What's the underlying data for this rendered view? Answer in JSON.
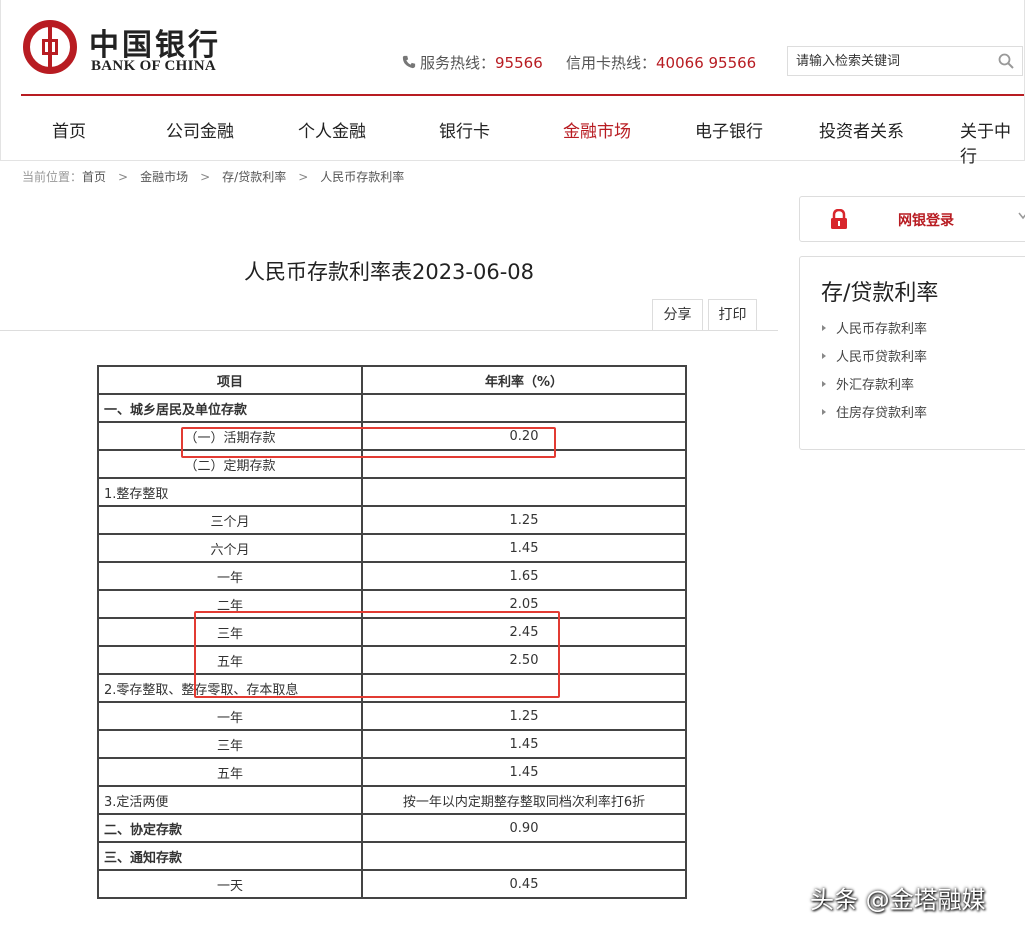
{
  "brand": {
    "name_cn": "中国银行",
    "name_en": "BANK OF CHINA",
    "color": "#b81c22"
  },
  "header": {
    "service_label": "服务热线：",
    "service_number": "95566",
    "credit_label": "信用卡热线：",
    "credit_number": "40066 95566",
    "search_placeholder": "请输入检索关键词",
    "icons": [
      "phone-icon",
      "search-icon"
    ]
  },
  "nav": [
    "首页",
    "公司金融",
    "个人金融",
    "银行卡",
    "金融市场",
    "电子银行",
    "投资者关系",
    "关于中行"
  ],
  "nav_active": "金融市场",
  "breadcrumb": {
    "prefix": "当前位置：",
    "items": [
      "首页",
      "金融市场",
      "存/贷款利率",
      "人民币存款利率"
    ]
  },
  "login": {
    "label": "网银登录",
    "icon": "lock-icon"
  },
  "sidebar": {
    "title": "存/贷款利率",
    "items": [
      "人民币存款利率",
      "人民币贷款利率",
      "外汇存款利率",
      "住房存贷款利率"
    ]
  },
  "document": {
    "title": "人民币存款利率表2023-06-08",
    "share": "分享",
    "print": "打印"
  },
  "table": {
    "headers": [
      "项目",
      "年利率（%）"
    ],
    "rows": [
      [
        "一、城乡居民及单位存款",
        ""
      ],
      [
        "（一）活期存款",
        "0.20"
      ],
      [
        "（二）定期存款",
        ""
      ],
      [
        "1.整存整取",
        ""
      ],
      [
        "三个月",
        "1.25"
      ],
      [
        "六个月",
        "1.45"
      ],
      [
        "一年",
        "1.65"
      ],
      [
        "二年",
        "2.05"
      ],
      [
        "三年",
        "2.45"
      ],
      [
        "五年",
        "2.50"
      ],
      [
        "2.零存整取、整存零取、存本取息",
        ""
      ],
      [
        "一年",
        "1.25"
      ],
      [
        "三年",
        "1.45"
      ],
      [
        "五年",
        "1.45"
      ],
      [
        "3.定活两便",
        "按一年以内定期整存整取同档次利率打6折"
      ],
      [
        "二、协定存款",
        "0.90"
      ],
      [
        "三、通知存款",
        ""
      ],
      [
        "一天",
        "0.45"
      ]
    ]
  },
  "highlight_color": "#e23b33",
  "watermark": "头条 @金塔融媒"
}
